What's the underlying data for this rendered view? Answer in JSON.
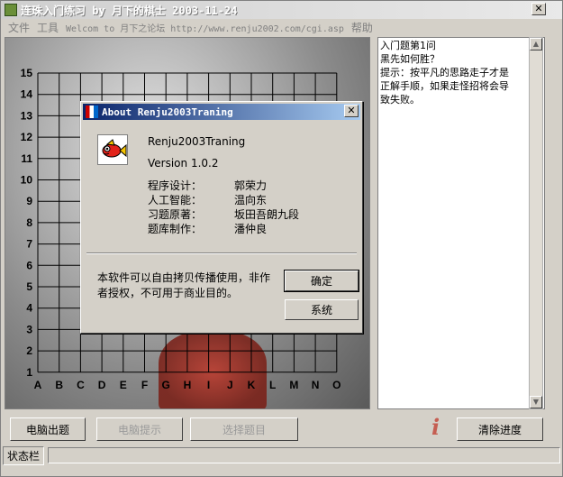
{
  "window": {
    "title": "连珠入门练习 by 月下的棋士 2003-11-24",
    "close_glyph": "✕"
  },
  "menu": {
    "file": "文件",
    "tools": "工具",
    "welcome": "Welcom to 月下之论坛 http://www.renju2002.com/cgi.asp",
    "help": "帮助"
  },
  "board": {
    "row_labels": [
      "15",
      "14",
      "13",
      "12",
      "11",
      "10",
      "9",
      "8",
      "7",
      "6",
      "5",
      "4",
      "3",
      "2",
      "1"
    ],
    "col_labels": [
      "A",
      "B",
      "C",
      "D",
      "E",
      "F",
      "G",
      "H",
      "I",
      "J",
      "K",
      "L",
      "M",
      "N",
      "O"
    ]
  },
  "puzzle": {
    "lines": [
      "入门题第1问",
      "黑先如何胜？",
      "提示：按平凡的思路走子才是",
      "正解手顺，如果走怪招将会导",
      "致失败。"
    ]
  },
  "buttons": {
    "computer_puzzle": "电脑出题",
    "computer_hint": "电脑提示",
    "select_puzzle": "选择题目",
    "clear_progress": "清除进度"
  },
  "statusbar": {
    "label": "状态栏"
  },
  "about_dialog": {
    "title": "About Renju2003Traning",
    "close_glyph": "✕",
    "app_name": "Renju2003Traning",
    "version": "Version 1.0.2",
    "credits": [
      {
        "role": "程序设计：",
        "name": "郭荣力"
      },
      {
        "role": "人工智能：",
        "name": "温向东"
      },
      {
        "role": "习题原著：",
        "name": "坂田吾朗九段"
      },
      {
        "role": "题库制作：",
        "name": "潘仲良"
      }
    ],
    "license_line1": "本软件可以自由拷贝传播使用，非作",
    "license_line2": "者授权，不可用于商业目的。",
    "ok": "确定",
    "system": "系统"
  },
  "colors": {
    "dialog_title_start": "#0a246a",
    "dialog_title_end": "#a6caf0",
    "window_face": "#d4d0c8"
  }
}
